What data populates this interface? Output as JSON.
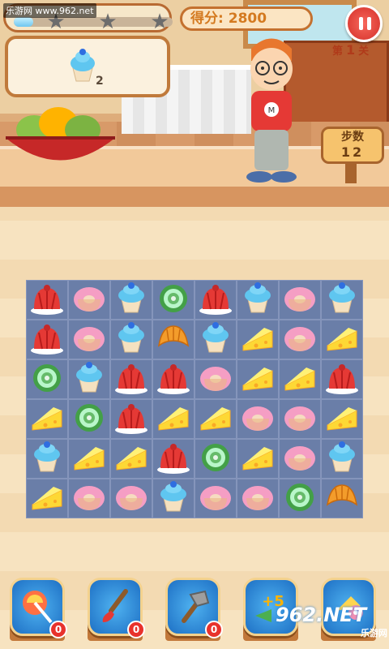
{
  "hud": {
    "watermark_text": "乐游网 www.962.net",
    "score_label": "得分:",
    "score_value": "2800",
    "level_prefix": "第",
    "level_number": "1",
    "level_suffix": "关",
    "progress_fraction": 0.12,
    "stars_filled": 0,
    "stars_total": 3
  },
  "target": {
    "item_icon": "blue-cupcake-icon",
    "remaining": "2"
  },
  "steps": {
    "title": "步数",
    "value": "12"
  },
  "board": {
    "rows": [
      [
        "jelly",
        "donut",
        "cupcake",
        "candy",
        "jelly",
        "cupcake",
        "donut",
        "cupcake"
      ],
      [
        "jelly",
        "donut",
        "cupcake",
        "croissant",
        "cupcake",
        "cheese",
        "donut",
        "cheese"
      ],
      [
        "candy",
        "cupcake",
        "jelly",
        "jelly",
        "donut",
        "cheese",
        "cheese",
        "jelly"
      ],
      [
        "cheese",
        "candy",
        "jelly",
        "cheese",
        "cheese",
        "donut",
        "donut",
        "cheese"
      ],
      [
        "cupcake",
        "cheese",
        "cheese",
        "jelly",
        "candy",
        "cheese",
        "donut",
        "cupcake"
      ],
      [
        "cheese",
        "donut",
        "donut",
        "cupcake",
        "donut",
        "donut",
        "candy",
        "croissant"
      ]
    ]
  },
  "powerups": [
    {
      "name": "lollipop-icon",
      "count": "0"
    },
    {
      "name": "paintbrush-icon",
      "count": "0"
    },
    {
      "name": "hammer-icon",
      "count": "0"
    },
    {
      "name": "plus5-moves-icon",
      "count": "+5"
    },
    {
      "name": "shuffle-icon",
      "count": ""
    }
  ],
  "plus5_label": "+5",
  "brand": {
    "text": "962.NET",
    "sub": "乐游网"
  }
}
